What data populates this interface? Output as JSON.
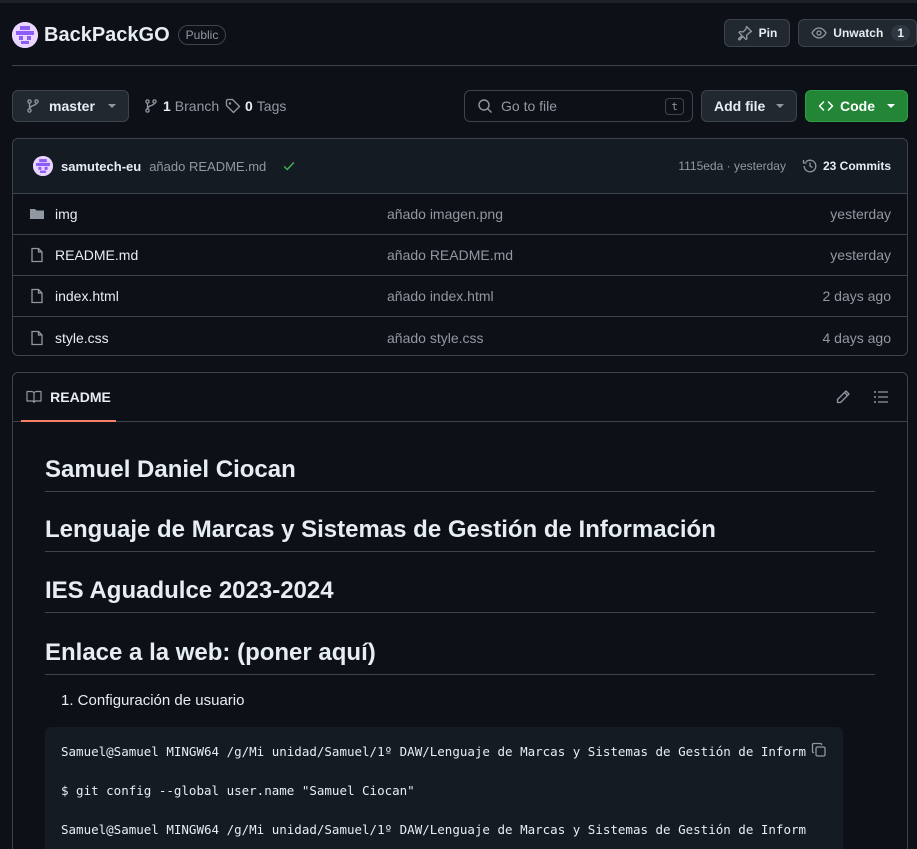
{
  "repo": {
    "name": "BackPackGO",
    "visibility": "Public",
    "pin_label": "Pin",
    "watch_label": "Unwatch",
    "watch_count": "1"
  },
  "toolbar": {
    "branch": "master",
    "branch_count": "1",
    "branch_label": "Branch",
    "tag_count": "0",
    "tag_label": "Tags",
    "goto_placeholder": "Go to file",
    "goto_kbd": "t",
    "add_file_label": "Add file",
    "code_label": "Code"
  },
  "latest_commit": {
    "author": "samutech-eu",
    "message": "añado README.md",
    "hash_time": "1115eda · yesterday",
    "commits_label": "23 Commits"
  },
  "files": [
    {
      "name": "img",
      "type": "folder",
      "message": "añado imagen.png",
      "date": "yesterday"
    },
    {
      "name": "README.md",
      "type": "file",
      "message": "añado README.md",
      "date": "yesterday"
    },
    {
      "name": "index.html",
      "type": "file",
      "message": "añado index.html",
      "date": "2 days ago"
    },
    {
      "name": "style.css",
      "type": "file",
      "message": "añado style.css",
      "date": "4 days ago"
    }
  ],
  "readme": {
    "tab_label": "README",
    "headings": [
      "Samuel Daniel Ciocan",
      "Lenguaje de Marcas y Sistemas de Gestión de Información",
      "IES Aguadulce 2023-2024",
      "Enlace a la web: (poner aquí)"
    ],
    "list_item": "1. Configuración de usuario",
    "code_lines": [
      "Samuel@Samuel MINGW64 /g/Mi unidad/Samuel/1º DAW/Lenguaje de Marcas y Sistemas de Gestión de Inform",
      "$ git config --global user.name \"Samuel Ciocan\"",
      "Samuel@Samuel MINGW64 /g/Mi unidad/Samuel/1º DAW/Lenguaje de Marcas y Sistemas de Gestión de Inform"
    ]
  },
  "colors": {
    "background": "#0d1117",
    "border": "#3d444d",
    "code_button": "#238636",
    "tab_underline": "#f78166",
    "check": "#3fb950"
  }
}
